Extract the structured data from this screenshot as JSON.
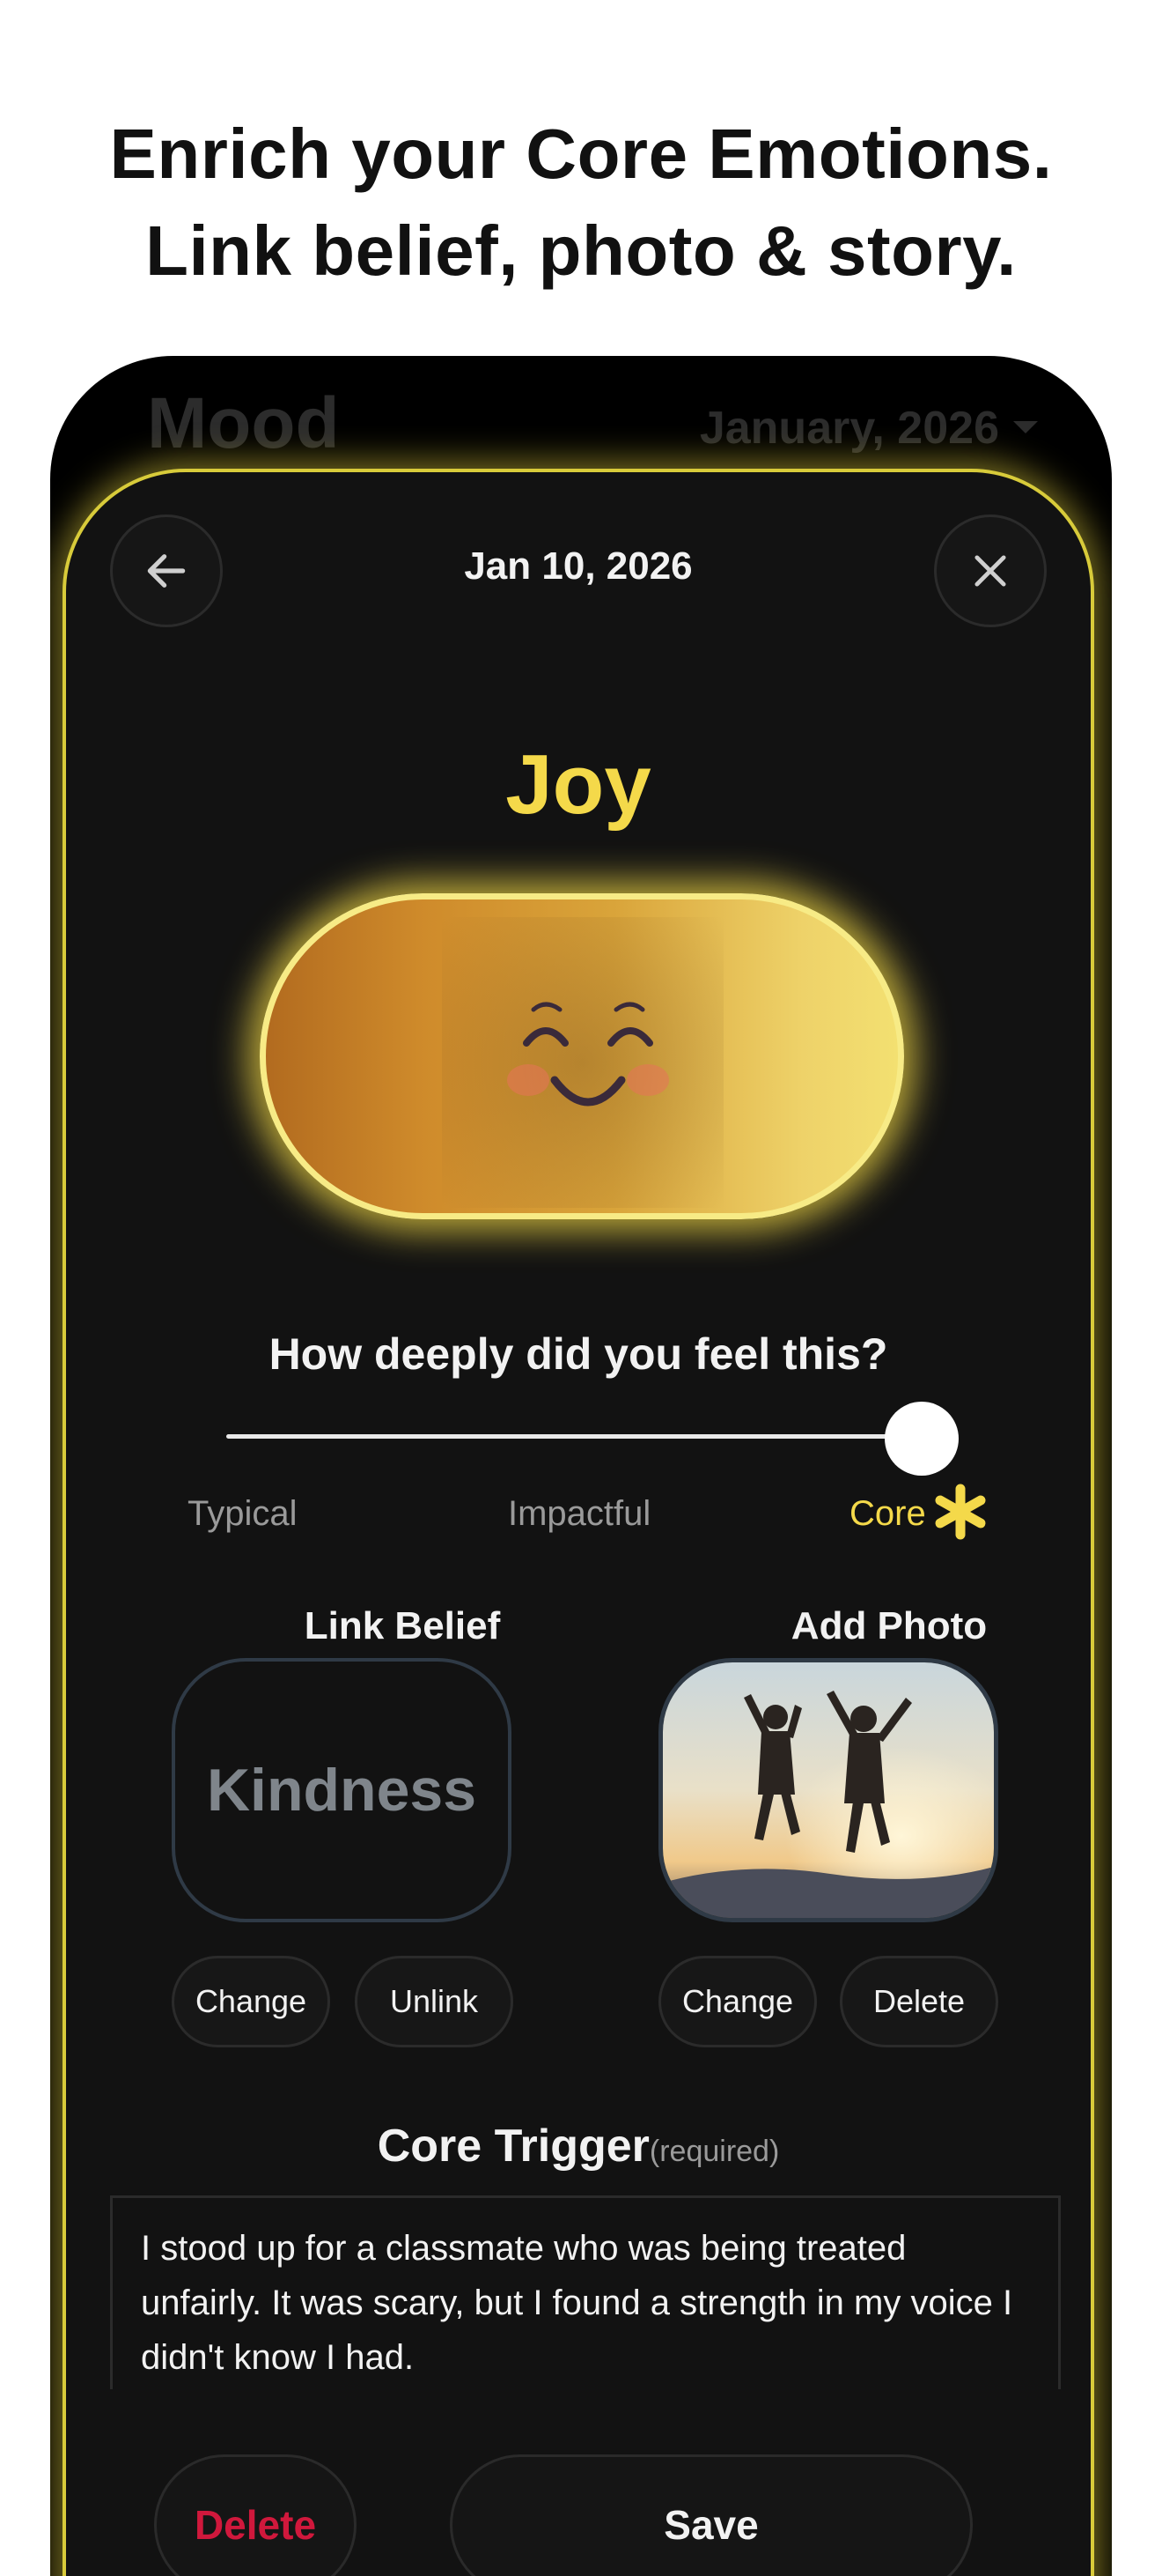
{
  "headline": {
    "line1": "Enrich your Core Emotions.",
    "line2": "Link belief, photo & story."
  },
  "background": {
    "title": "Mood",
    "month": "January, 2026"
  },
  "sheet": {
    "date": "Jan 10, 2026",
    "emotion": "Joy",
    "question": "How deeply did you feel this?",
    "intensity": {
      "levels": [
        "Typical",
        "Impactful",
        "Core"
      ],
      "selected": "Core",
      "value_fraction": 1.0
    },
    "belief": {
      "label": "Link Belief",
      "value": "Kindness",
      "change_label": "Change",
      "unlink_label": "Unlink"
    },
    "photo": {
      "label": "Add Photo",
      "change_label": "Change",
      "delete_label": "Delete"
    },
    "trigger": {
      "title": "Core Trigger",
      "required": "(required)",
      "text": "I stood up for a classmate who was being treated unfairly. It was scary, but I found a strength in my voice I didn't know I had."
    },
    "actions": {
      "delete_label": "Delete",
      "save_label": "Save"
    }
  },
  "colors": {
    "accent": "#f4d94a",
    "danger": "#d0183c",
    "background": "#121212"
  }
}
